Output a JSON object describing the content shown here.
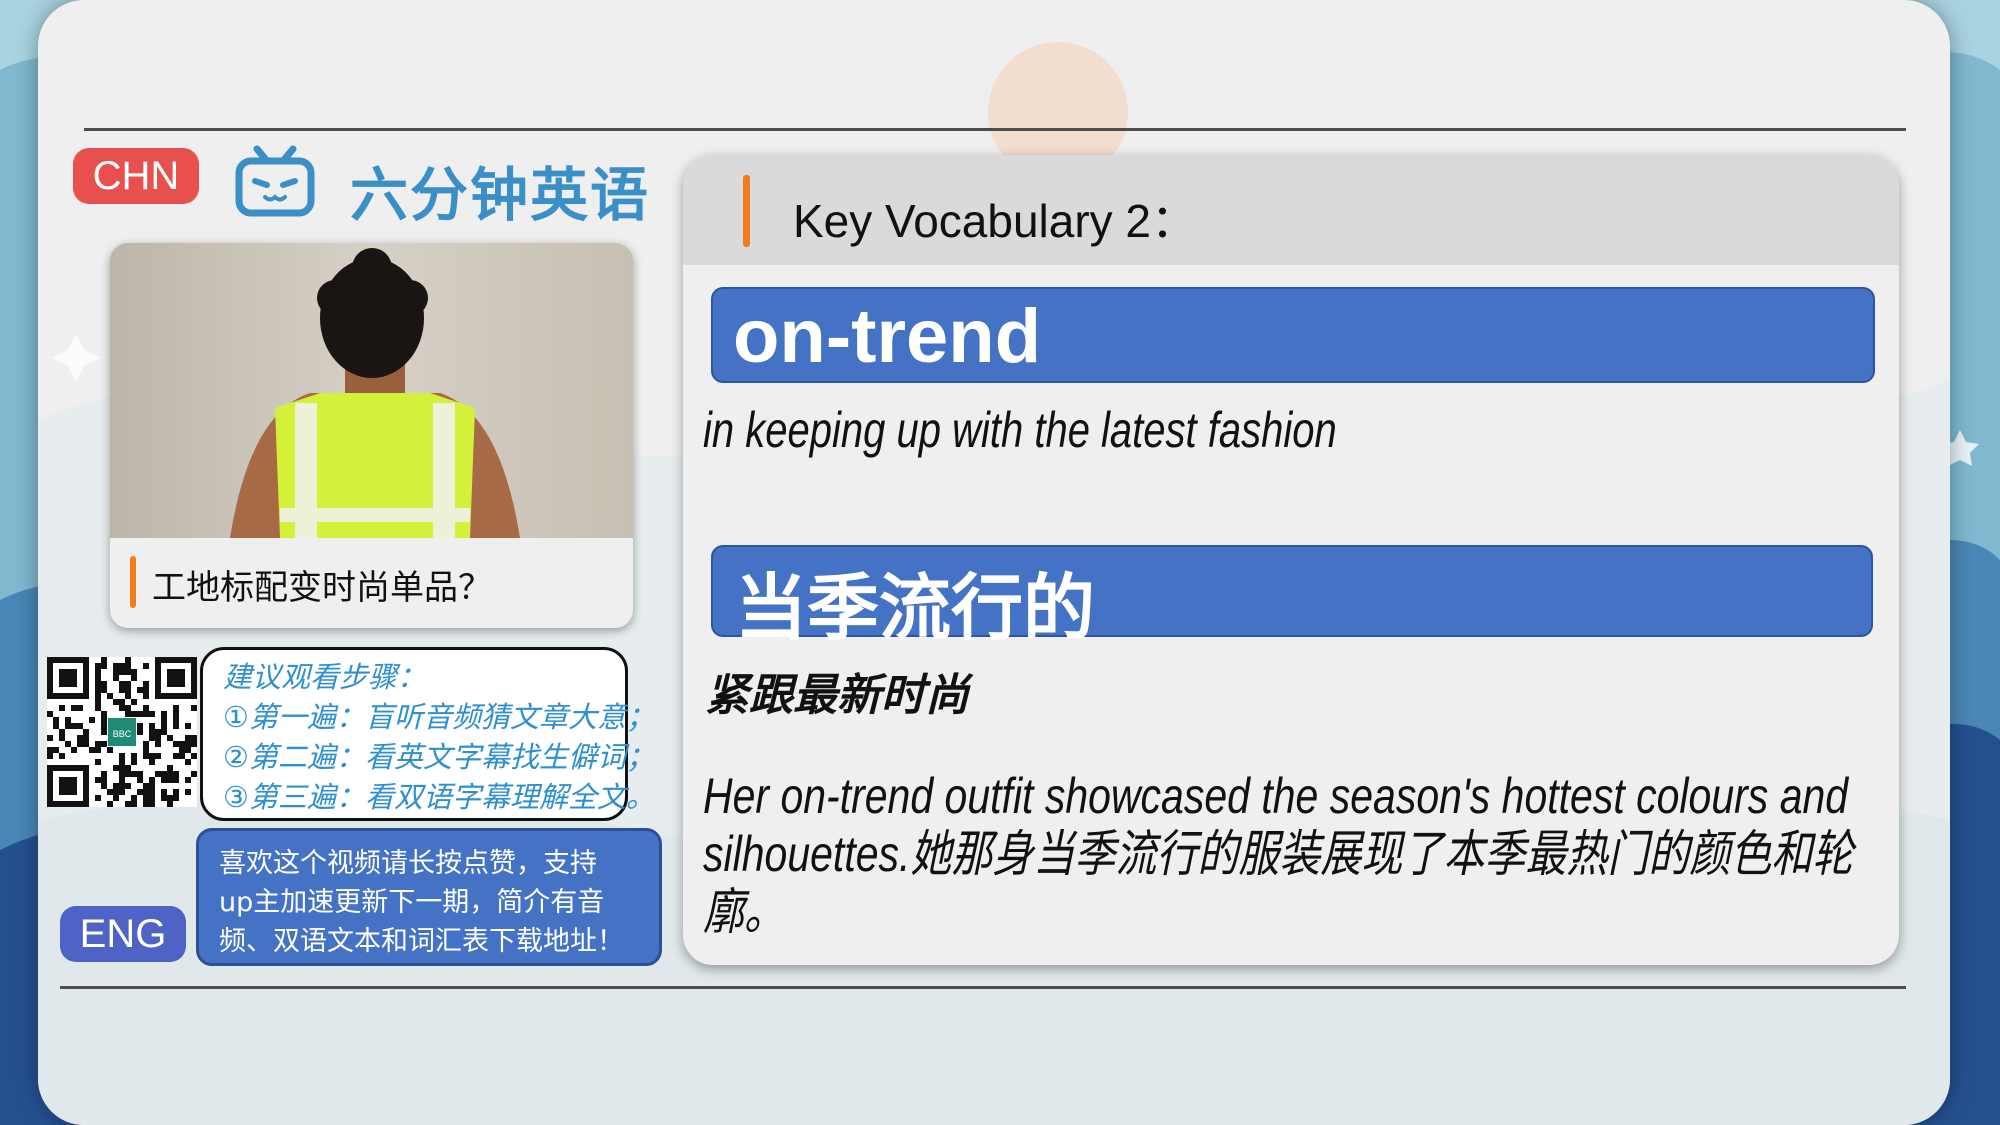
{
  "badges": {
    "chn": "CHN",
    "eng": "ENG"
  },
  "brand": {
    "name": "六分钟英语",
    "icon": "bilibili-tv-icon",
    "color": "#3a8fc7"
  },
  "thumbnail": {
    "caption": "工地标配变时尚单品？"
  },
  "qr": {
    "center_logo": "BBC"
  },
  "steps": {
    "title": "建议观看步骤：",
    "items": [
      "①第一遍：盲听音频猜文章大意；",
      "②第二遍：看英文字幕找生僻词；",
      "③第三遍：看双语字幕理解全文。"
    ]
  },
  "promo": {
    "lines": [
      "喜欢这个视频请长按点赞，支持",
      "up主加速更新下一期，简介有音",
      "频、双语文本和词汇表下载地址！"
    ]
  },
  "vocab": {
    "heading": "Key Vocabulary 2：",
    "word_en": "on-trend",
    "definition_en": "in keeping up with the latest fashion",
    "word_zh": "当季流行的",
    "definition_zh": "紧跟最新时尚",
    "example": "Her on-trend outfit showcased the season's hottest colours and silhouettes.她那身当季流行的服装展现了本季最热门的颜色和轮廓。"
  },
  "colors": {
    "accent_blue": "#4472c4",
    "accent_orange": "#f07c1d",
    "chn_badge": "#e8504f",
    "eng_badge": "#4f62c6"
  }
}
